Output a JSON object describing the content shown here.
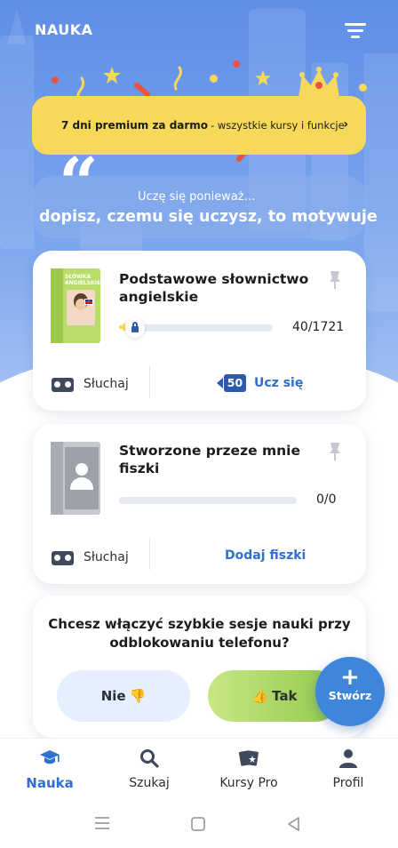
{
  "header": {
    "title": "NAUKA",
    "filter_icon": "filter-lines-icon"
  },
  "colors": {
    "hero": "#6b98ea",
    "promo": "#f7d95a",
    "accent": "#2f6fd1",
    "fab": "#3d86dc",
    "yes_green": "#a8d45e",
    "no_blue": "#e5efff"
  },
  "promo": {
    "bold_text": "7 dni premium za darmo",
    "rest_text": "- wszystkie kursy i funkcje",
    "chevron": "›"
  },
  "motivation": {
    "quote_glyph": "“",
    "lead": "Uczę się ponieważ…",
    "prompt": "dopisz, czemu się uczysz, to motywuje"
  },
  "courses": [
    {
      "title_line1": "Podstawowe słownictwo",
      "title_line2": "angielskie",
      "progress_text": "40/1721",
      "progress": 0.023,
      "cover_title": "SŁÓWKA ANGIELSKIE",
      "listen_label": "Słuchaj",
      "badge": "50",
      "action": "Ucz się"
    },
    {
      "title_line1": "Stworzone przeze mnie",
      "title_line2": "fiszki",
      "progress_text": "0/0",
      "progress": 0,
      "listen_label": "Słuchaj",
      "action": "Dodaj fiszki"
    }
  ],
  "unlock": {
    "question_line1": "Chcesz włączyć szybkie sesje nauki przy",
    "question_line2": "odblokowaniu telefonu?",
    "no_label": "Nie",
    "no_emoji": "👎",
    "yes_label": "Tak",
    "yes_emoji": "👍"
  },
  "fab": {
    "plus": "+",
    "label": "Stwórz"
  },
  "nav": [
    {
      "label": "Nauka",
      "icon": "graduation-cap-icon",
      "active": true
    },
    {
      "label": "Szukaj",
      "icon": "search-icon",
      "active": false
    },
    {
      "label": "Kursy Pro",
      "icon": "cards-icon",
      "active": false
    },
    {
      "label": "Profil",
      "icon": "person-icon",
      "active": false
    }
  ]
}
